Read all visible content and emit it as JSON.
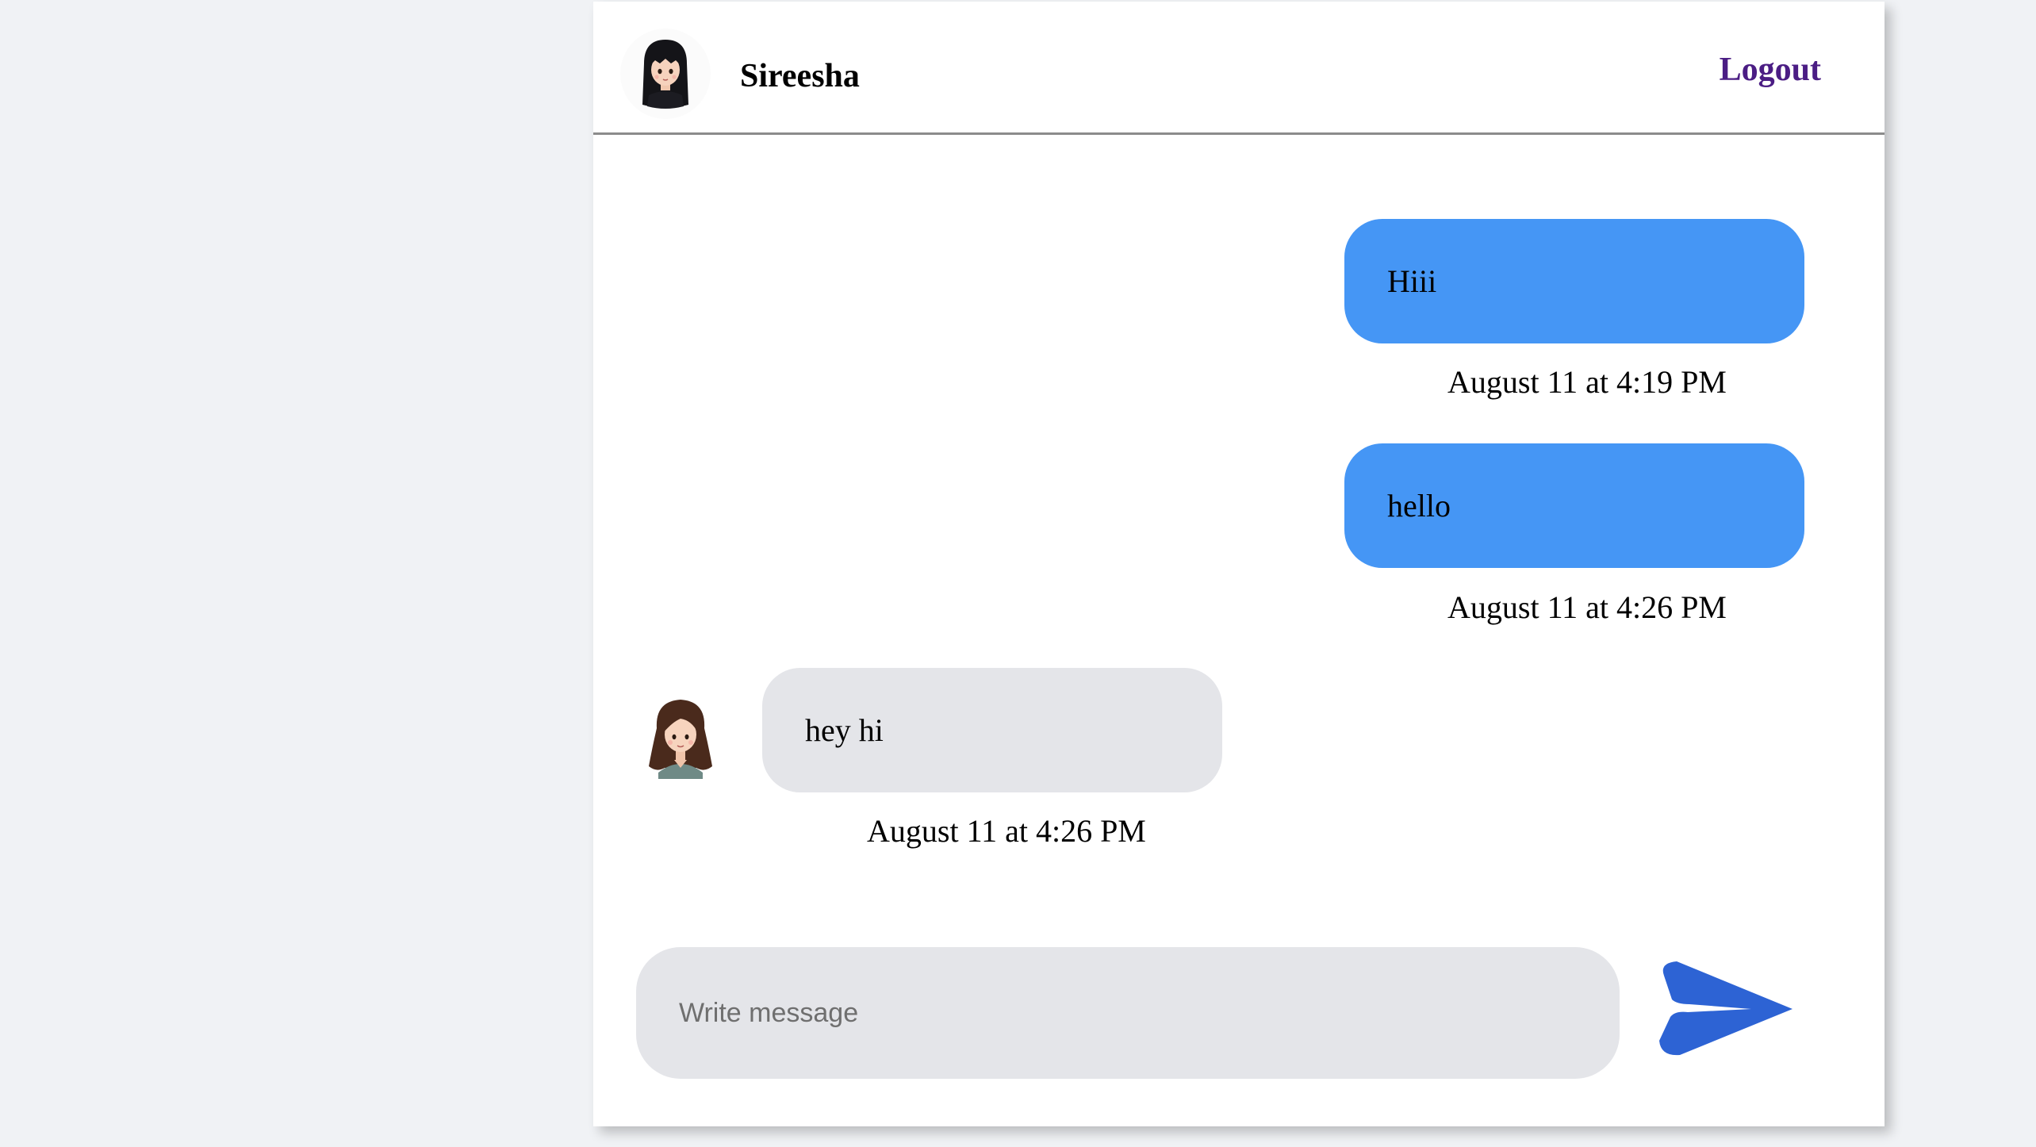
{
  "header": {
    "user_name": "Sireesha",
    "logout_label": "Logout",
    "avatar_icon": "girl-black-hair-avatar-icon"
  },
  "messages": [
    {
      "direction": "sent",
      "text": "Hiii",
      "time": "August 11 at 4:19 PM"
    },
    {
      "direction": "sent",
      "text": "hello",
      "time": "August 11 at 4:26 PM"
    },
    {
      "direction": "received",
      "text": "hey hi",
      "time": "August 11 at 4:26 PM",
      "avatar_icon": "girl-brown-hair-avatar-icon"
    }
  ],
  "composer": {
    "placeholder": "Write message",
    "value": "",
    "send_icon": "paper-plane-send-icon"
  },
  "colors": {
    "sent_bubble": "#4596f5",
    "received_bubble": "#e4e5e9",
    "logout_text": "#4b1d84",
    "send_icon": "#2d63d4",
    "page_background": "#f0f2f5"
  }
}
